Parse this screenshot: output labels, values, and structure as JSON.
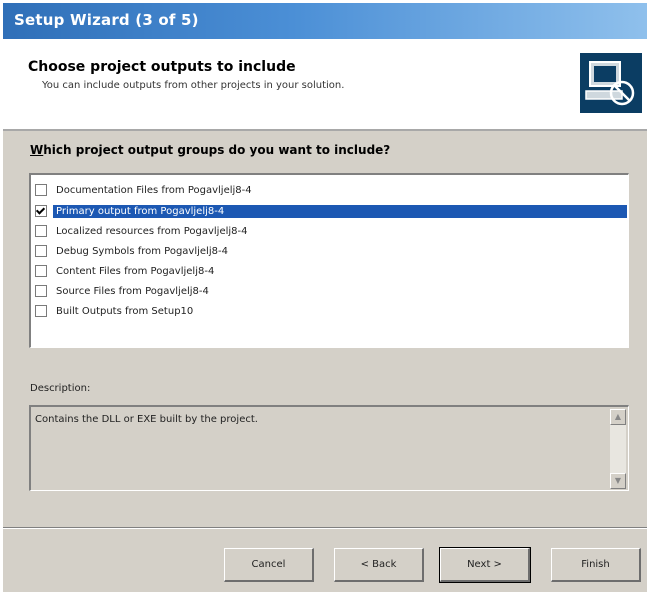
{
  "window": {
    "title": "Setup Wizard (3 of 5)"
  },
  "header": {
    "title": "Choose project outputs to include",
    "subtitle": "You can include outputs from other projects in your solution."
  },
  "question": {
    "lead": "W",
    "rest": "hich project output groups do you want to include?"
  },
  "outputs": [
    {
      "label": "Documentation Files from Pogavljelj8-4",
      "checked": false,
      "selected": false
    },
    {
      "label": "Primary output from Pogavljelj8-4",
      "checked": true,
      "selected": true
    },
    {
      "label": "Localized resources from Pogavljelj8-4",
      "checked": false,
      "selected": false
    },
    {
      "label": "Debug Symbols from Pogavljelj8-4",
      "checked": false,
      "selected": false
    },
    {
      "label": "Content Files from Pogavljelj8-4",
      "checked": false,
      "selected": false
    },
    {
      "label": "Source Files from Pogavljelj8-4",
      "checked": false,
      "selected": false
    },
    {
      "label": "Built Outputs from Setup10",
      "checked": false,
      "selected": false
    }
  ],
  "description": {
    "label": "Description:",
    "text": "Contains the DLL or EXE built by the project."
  },
  "buttons": {
    "cancel": "Cancel",
    "back": "< Back",
    "next": "Next >",
    "finish": "Finish"
  },
  "colors": {
    "titlebar": "#2f6fb8",
    "selection": "#1c58b3",
    "dialog_bg": "#d4d0c8"
  }
}
